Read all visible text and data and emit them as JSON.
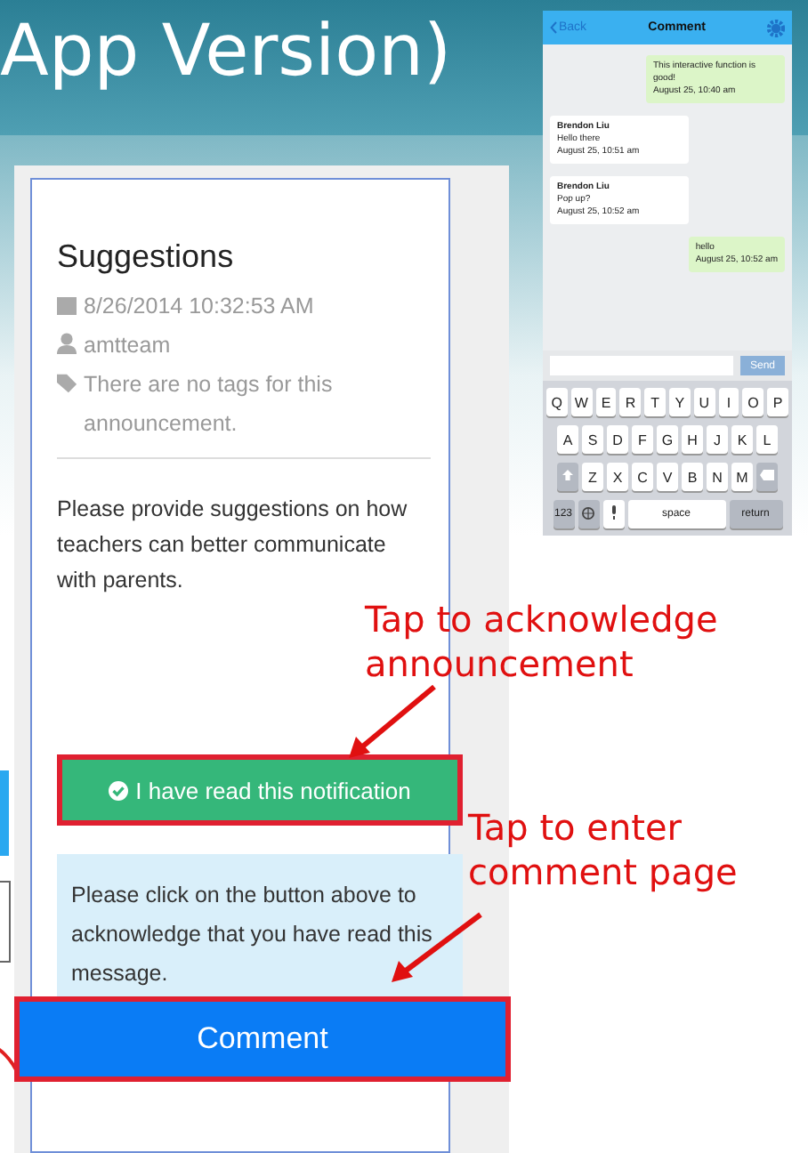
{
  "slide": {
    "title": "App Version)"
  },
  "announcement": {
    "title": "Suggestions",
    "date": "8/26/2014 10:32:53 AM",
    "author": "amtteam",
    "tags": "There are no tags for this announcement.",
    "body": "Please provide suggestions on how teachers can better communicate with parents.",
    "read_button": "I have read this notification",
    "notice": "Please click on the button above to acknowledge that you have read this message.",
    "comment_button": "Comment"
  },
  "chat": {
    "back": "Back",
    "title": "Comment",
    "messages": [
      {
        "mine": true,
        "text": "This interactive function is good!",
        "time": "August 25, 10:40 am"
      },
      {
        "mine": false,
        "author": "Brendon Liu",
        "text": "Hello there",
        "time": "August 25, 10:51 am"
      },
      {
        "mine": false,
        "author": "Brendon Liu",
        "text": "Pop up?",
        "time": "August 25, 10:52 am"
      },
      {
        "mine": true,
        "text": "hello",
        "time": "August 25, 10:52 am"
      }
    ],
    "send": "Send",
    "keyboard": [
      [
        "Q",
        "W",
        "E",
        "R",
        "T",
        "Y",
        "U",
        "I",
        "O",
        "P"
      ],
      [
        "A",
        "S",
        "D",
        "F",
        "G",
        "H",
        "J",
        "K",
        "L"
      ],
      [
        "Z",
        "X",
        "C",
        "V",
        "B",
        "N",
        "M"
      ]
    ],
    "num_key": "123",
    "space_key": "space",
    "return_key": "return"
  },
  "annotations": [
    "Tap to acknowledge announcement",
    "Tap to enter comment page"
  ]
}
